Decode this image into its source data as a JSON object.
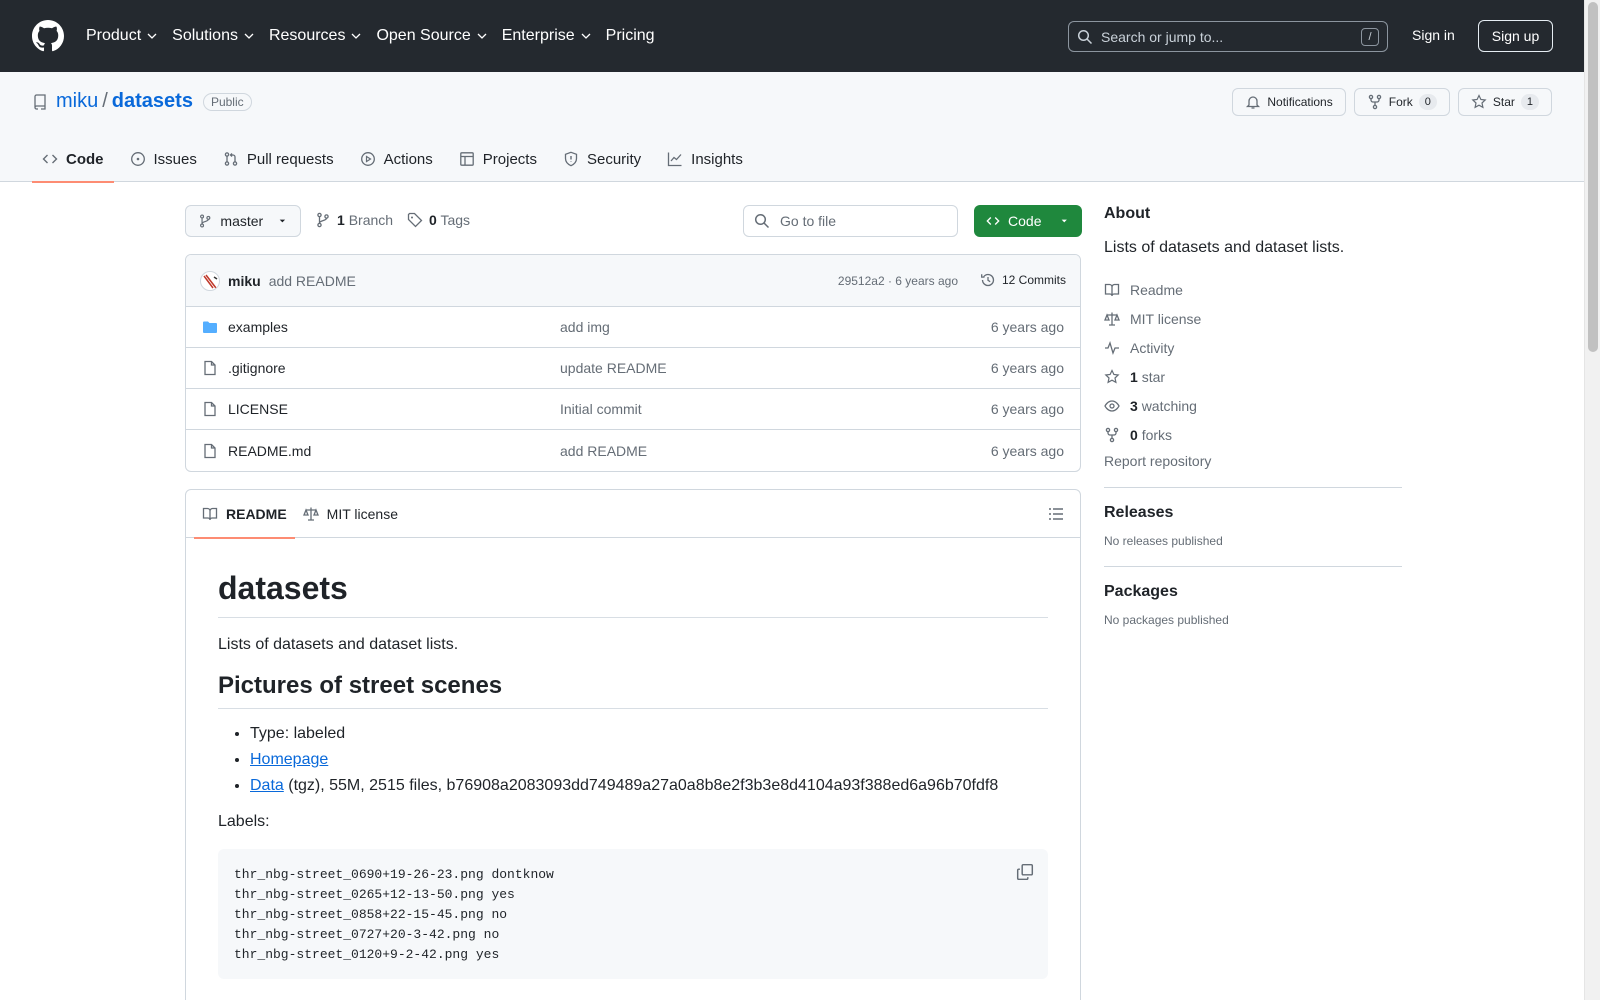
{
  "topnav": {
    "items": [
      "Product",
      "Solutions",
      "Resources",
      "Open Source",
      "Enterprise",
      "Pricing"
    ],
    "search_placeholder": "Search or jump to...",
    "search_shortcut": "/",
    "signin": "Sign in",
    "signup": "Sign up"
  },
  "repo": {
    "owner": "miku",
    "separator": "/",
    "name": "datasets",
    "visibility": "Public",
    "notifications": "Notifications",
    "fork_label": "Fork",
    "fork_count": "0",
    "star_label": "Star",
    "star_count": "1"
  },
  "tabs": [
    "Code",
    "Issues",
    "Pull requests",
    "Actions",
    "Projects",
    "Security",
    "Insights"
  ],
  "toolbar": {
    "branch": "master",
    "branch_count": "1",
    "branch_label": "Branch",
    "tag_count": "0",
    "tag_label": "Tags",
    "goto_file": "Go to file",
    "code_button": "Code"
  },
  "commit": {
    "author": "miku",
    "message": "add README",
    "meta": "29512a2 · 6 years ago",
    "commits": "12 Commits"
  },
  "files": [
    {
      "name": "examples",
      "type": "folder",
      "commit": "add img",
      "age": "6 years ago"
    },
    {
      "name": ".gitignore",
      "type": "file",
      "commit": "update README",
      "age": "6 years ago"
    },
    {
      "name": "LICENSE",
      "type": "file",
      "commit": "Initial commit",
      "age": "6 years ago"
    },
    {
      "name": "README.md",
      "type": "file",
      "commit": "add README",
      "age": "6 years ago"
    }
  ],
  "readme": {
    "tab_readme": "README",
    "tab_license": "MIT license",
    "title": "datasets",
    "intro": "Lists of datasets and dataset lists.",
    "section_title": "Pictures of street scenes",
    "bullet_type": "Type: labeled",
    "bullet_homepage": "Homepage",
    "bullet_data_link": "Data",
    "bullet_data_rest": " (tgz), 55M, 2515 files, b76908a2083093dd749489a27a0a8b8e2f3b3e8d4104a93f388ed6a96b70fdf8",
    "labels_heading": "Labels:",
    "code_lines": [
      "thr_nbg-street_0690+19-26-23.png dontknow",
      "thr_nbg-street_0265+12-13-50.png yes",
      "thr_nbg-street_0858+22-15-45.png no",
      "thr_nbg-street_0727+20-3-42.png no",
      "thr_nbg-street_0120+9-2-42.png yes"
    ]
  },
  "sidebar": {
    "about_title": "About",
    "about_desc": "Lists of datasets and dataset lists.",
    "readme": "Readme",
    "license": "MIT license",
    "activity": "Activity",
    "stars_count": "1",
    "stars_label": "star",
    "watching_count": "3",
    "watching_label": "watching",
    "forks_count": "0",
    "forks_label": "forks",
    "report": "Report repository",
    "releases_title": "Releases",
    "releases_text": "No releases published",
    "packages_title": "Packages",
    "packages_text": "No packages published"
  },
  "colors": {
    "header_bg": "#24292f",
    "link": "#0969da",
    "code_button": "#1f883d",
    "tab_underline": "#fd8c73"
  }
}
